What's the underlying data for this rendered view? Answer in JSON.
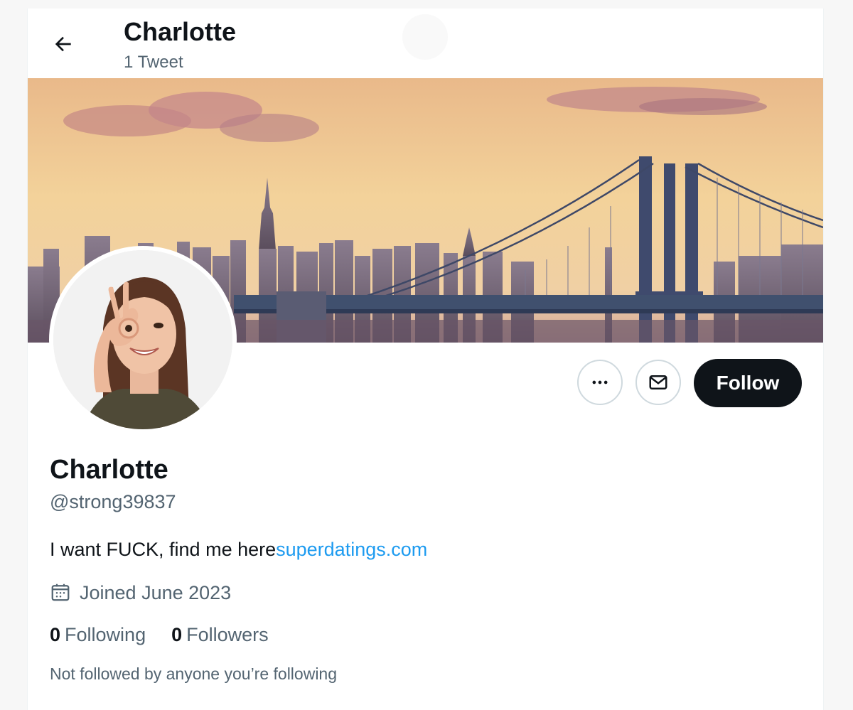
{
  "header": {
    "title": "Charlotte",
    "subtitle": "1 Tweet"
  },
  "icons": {
    "back": "arrow-left-icon",
    "more": "more-dots-icon",
    "message": "envelope-icon",
    "calendar": "calendar-icon"
  },
  "actions": {
    "follow_label": "Follow"
  },
  "profile": {
    "name": "Charlotte",
    "handle": "@strong39837",
    "bio_text": "I want FUCK, find me here",
    "bio_link": "superdatings.com",
    "joined": "Joined June 2023",
    "following_count": "0",
    "following_label": "Following",
    "followers_count": "0",
    "followers_label": "Followers",
    "not_followed": "Not followed by anyone you’re following"
  },
  "colors": {
    "text_primary": "#0f1419",
    "text_secondary": "#536471",
    "link": "#1d9bf0",
    "button_dark": "#0f1419",
    "border": "#cfd9de"
  }
}
